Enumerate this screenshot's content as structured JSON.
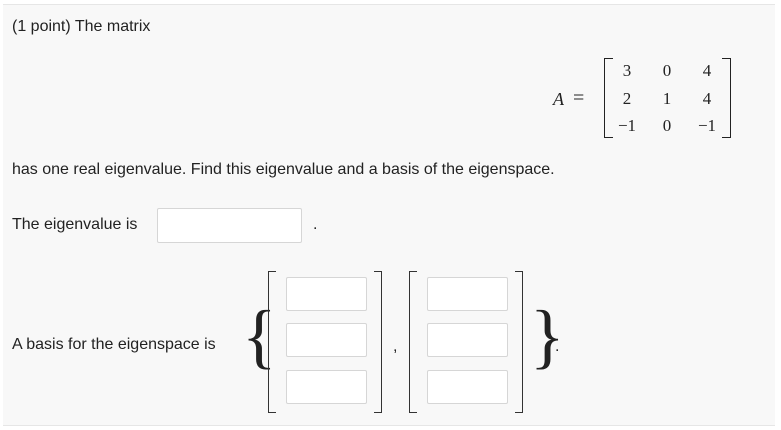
{
  "problem": {
    "intro": "(1 point) The matrix",
    "matrix_label": "A",
    "equals": "=",
    "matrix": [
      [
        "3",
        "0",
        "4"
      ],
      [
        "2",
        "1",
        "4"
      ],
      [
        "−1",
        "0",
        "−1"
      ]
    ],
    "statement": "has one real eigenvalue. Find this eigenvalue and a basis of the eigenspace."
  },
  "eigenvalue": {
    "label": "The eigenvalue is",
    "value": "",
    "suffix": "."
  },
  "basis": {
    "label": "A basis for the eigenspace is",
    "open_brace": "{",
    "close_brace": "}",
    "separator": ",",
    "end": ".",
    "vectors": [
      [
        "",
        "",
        ""
      ],
      [
        "",
        "",
        ""
      ]
    ]
  }
}
